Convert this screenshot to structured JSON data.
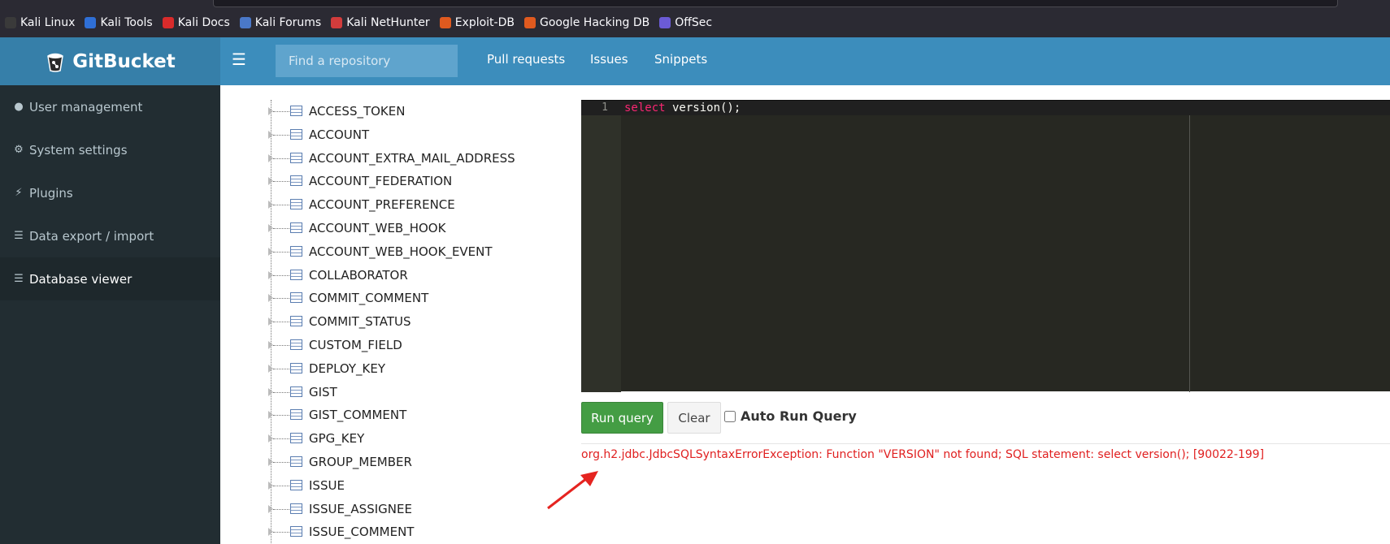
{
  "browser": {
    "bookmarks": [
      {
        "label": "Kali Linux",
        "icon": "kali-icon",
        "color": "#3a3a3a"
      },
      {
        "label": "Kali Tools",
        "icon": "kali-tools-icon",
        "color": "#2f6fd6"
      },
      {
        "label": "Kali Docs",
        "icon": "kali-docs-icon",
        "color": "#d92b2b"
      },
      {
        "label": "Kali Forums",
        "icon": "kali-forums-icon",
        "color": "#4a78c8"
      },
      {
        "label": "Kali NetHunter",
        "icon": "nethunter-icon",
        "color": "#d23c3c"
      },
      {
        "label": "Exploit-DB",
        "icon": "exploit-db-icon",
        "color": "#e05a1f"
      },
      {
        "label": "Google Hacking DB",
        "icon": "ghdb-icon",
        "color": "#e05a1f"
      },
      {
        "label": "OffSec",
        "icon": "offsec-icon",
        "color": "#6b5bd6"
      }
    ]
  },
  "header": {
    "brand": "GitBucket",
    "search_placeholder": "Find a repository",
    "nav": [
      "Pull requests",
      "Issues",
      "Snippets"
    ]
  },
  "sidebar": {
    "items": [
      {
        "label": "User management",
        "icon": "user-icon",
        "active": false
      },
      {
        "label": "System settings",
        "icon": "gear-icon",
        "active": false
      },
      {
        "label": "Plugins",
        "icon": "plug-icon",
        "active": false
      },
      {
        "label": "Data export / import",
        "icon": "database-icon",
        "active": false
      },
      {
        "label": "Database viewer",
        "icon": "database-icon",
        "active": true
      }
    ]
  },
  "tables": [
    "ACCESS_TOKEN",
    "ACCOUNT",
    "ACCOUNT_EXTRA_MAIL_ADDRESS",
    "ACCOUNT_FEDERATION",
    "ACCOUNT_PREFERENCE",
    "ACCOUNT_WEB_HOOK",
    "ACCOUNT_WEB_HOOK_EVENT",
    "COLLABORATOR",
    "COMMIT_COMMENT",
    "COMMIT_STATUS",
    "CUSTOM_FIELD",
    "DEPLOY_KEY",
    "GIST",
    "GIST_COMMENT",
    "GPG_KEY",
    "GROUP_MEMBER",
    "ISSUE",
    "ISSUE_ASSIGNEE",
    "ISSUE_COMMENT"
  ],
  "editor": {
    "line_number": "1",
    "keyword": "select",
    "rest": " version();"
  },
  "actions": {
    "run_label": "Run query",
    "clear_label": "Clear",
    "auto_run_label": "Auto Run Query"
  },
  "result": {
    "error": "org.h2.jdbc.JdbcSQLSyntaxErrorException: Function \"VERSION\" not found; SQL statement: select version(); [90022-199]"
  },
  "colors": {
    "header": "#3c8dbc",
    "sidebar": "#222d32",
    "error": "#e02020",
    "run_button": "#449d44"
  }
}
